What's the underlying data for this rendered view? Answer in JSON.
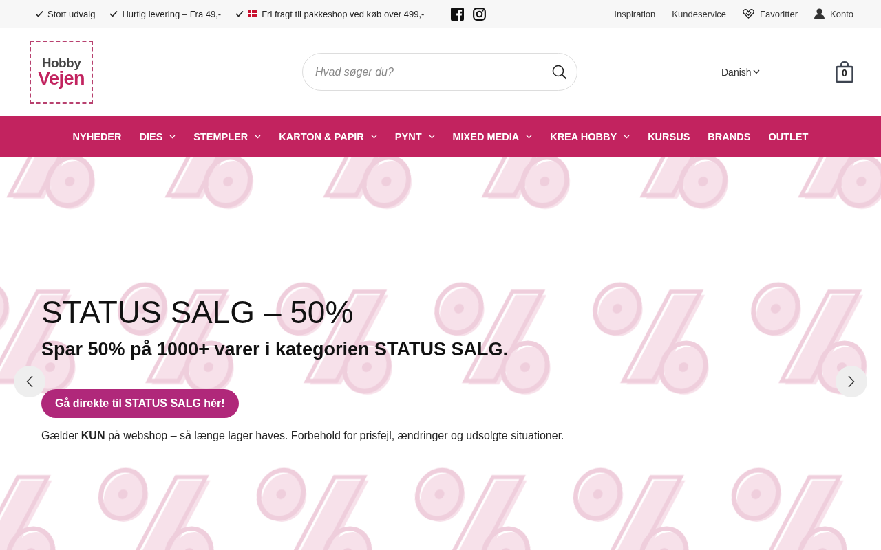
{
  "top_bar": {
    "usps": [
      {
        "label": "Stort udvalg",
        "flag": false
      },
      {
        "label": "Hurtig levering – Fra 49,-",
        "flag": false
      },
      {
        "label": "Fri fragt til pakkeshop ved køb over 499,-",
        "flag": true
      }
    ],
    "links": [
      {
        "label": "Inspiration",
        "kind": "plain"
      },
      {
        "label": "Kundeservice",
        "kind": "plain"
      },
      {
        "label": "Favoritter",
        "kind": "heart"
      },
      {
        "label": "Konto",
        "kind": "user"
      }
    ]
  },
  "header": {
    "logo": {
      "line_1": "Hobby",
      "line_2": "Vejen"
    },
    "search": {
      "placeholder": "Hvad søger du?"
    },
    "language": "Danish",
    "cart_count": "0"
  },
  "nav": [
    {
      "label": "NYHEDER",
      "dropdown": false
    },
    {
      "label": "DIES",
      "dropdown": true
    },
    {
      "label": "STEMPLER",
      "dropdown": true
    },
    {
      "label": "KARTON & PAPIR",
      "dropdown": true
    },
    {
      "label": "PYNT",
      "dropdown": true
    },
    {
      "label": "MIXED MEDIA",
      "dropdown": true
    },
    {
      "label": "KREA HOBBY",
      "dropdown": true
    },
    {
      "label": "KURSUS",
      "dropdown": false
    },
    {
      "label": "BRANDS",
      "dropdown": false
    },
    {
      "label": "OUTLET",
      "dropdown": false
    }
  ],
  "hero": {
    "kind": "picture",
    "title": "STATUS SALG – 50%",
    "subtitle": "Spar 50% på 1000+ varer i kategorien STATUS SALG.",
    "button": "Gå direkte til STATUS SALG hér!",
    "note": "Gælder **KUN** på webshop – så længe lager haves. Forbehold for prisfejl, ændringer og udsolgte situationer."
  }
}
